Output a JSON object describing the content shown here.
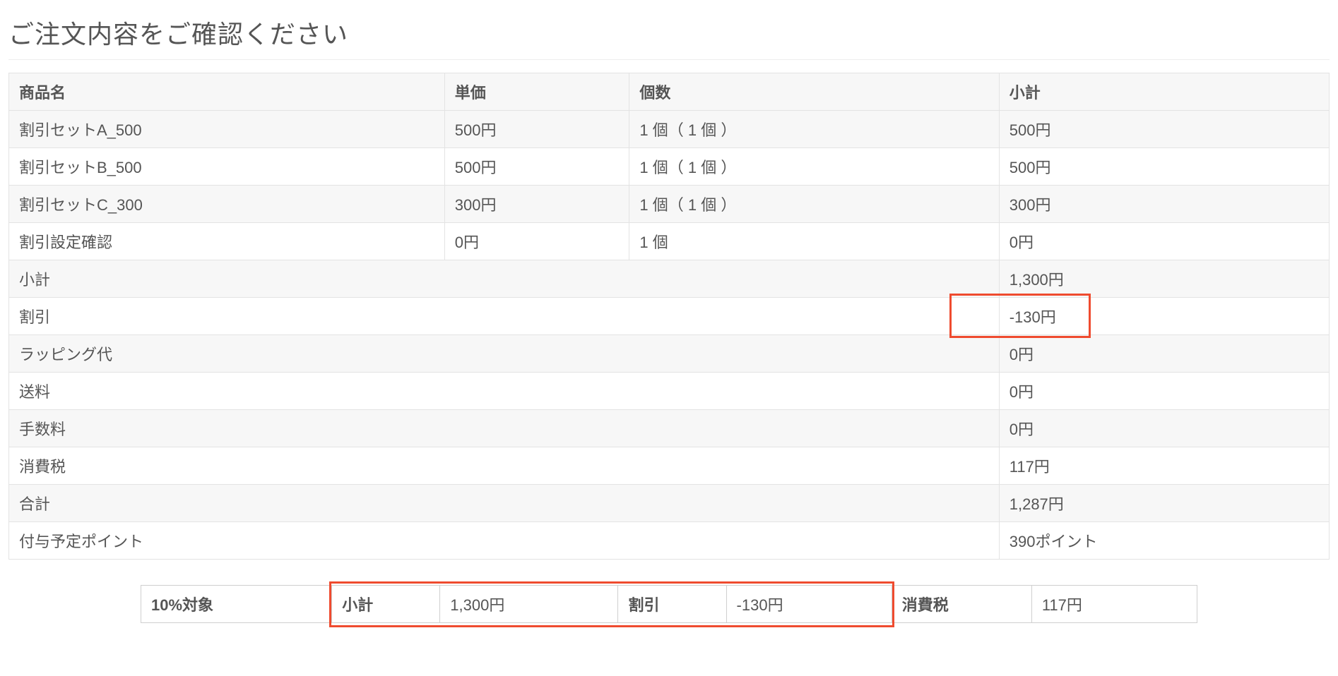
{
  "page_title": "ご注文内容をご確認ください",
  "table": {
    "headers": {
      "name": "商品名",
      "unit": "単価",
      "qty": "個数",
      "subtotal": "小計"
    },
    "rows": [
      {
        "name": "割引セットA_500",
        "unit": "500円",
        "qty": "1 個（ 1 個 ）",
        "subtotal": "500円"
      },
      {
        "name": "割引セットB_500",
        "unit": "500円",
        "qty": "1 個（ 1 個 ）",
        "subtotal": "500円"
      },
      {
        "name": "割引セットC_300",
        "unit": "300円",
        "qty": "1 個（ 1 個 ）",
        "subtotal": "300円"
      },
      {
        "name": "割引設定確認",
        "unit": "0円",
        "qty": "1 個",
        "subtotal": "0円"
      }
    ],
    "summary": {
      "subtotal": {
        "label": "小計",
        "value": "1,300円"
      },
      "discount": {
        "label": "割引",
        "value": "-130円"
      },
      "wrapping": {
        "label": "ラッピング代",
        "value": "0円"
      },
      "shipping": {
        "label": "送料",
        "value": "0円"
      },
      "fee": {
        "label": "手数料",
        "value": "0円"
      },
      "tax": {
        "label": "消費税",
        "value": "117円"
      },
      "total": {
        "label": "合計",
        "value": "1,287円"
      },
      "points": {
        "label": "付与予定ポイント",
        "value": "390ポイント"
      }
    }
  },
  "tax_row": {
    "rate_label": "10%対象",
    "subtotal_label": "小計",
    "subtotal_value": "1,300円",
    "discount_label": "割引",
    "discount_value": "-130円",
    "tax_label": "消費税",
    "tax_value": "117円"
  }
}
